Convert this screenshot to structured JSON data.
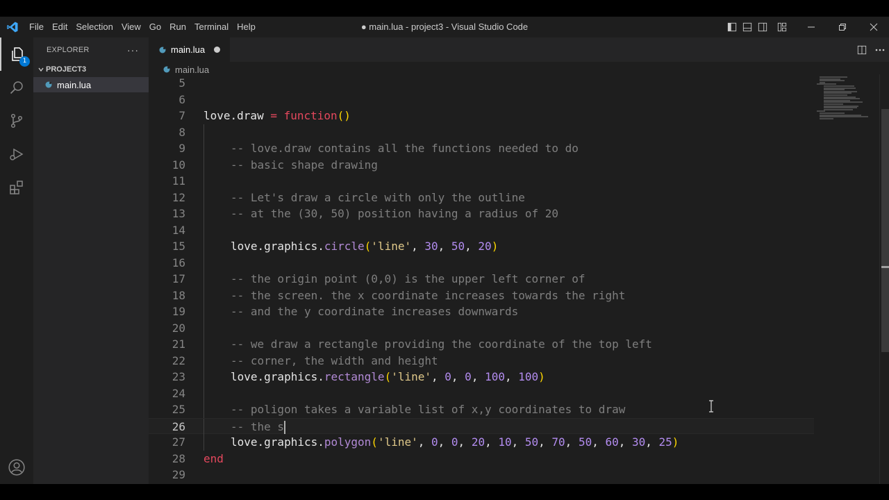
{
  "titlebar": {
    "menu": [
      "File",
      "Edit",
      "Selection",
      "View",
      "Go",
      "Run",
      "Terminal",
      "Help"
    ],
    "window_title": "● main.lua - project3 - Visual Studio Code"
  },
  "activitybar": {
    "items": [
      "explorer-icon",
      "search-icon",
      "source-control-icon",
      "run-debug-icon",
      "extensions-icon"
    ],
    "explorer_badge": "1",
    "bottom": "account-icon"
  },
  "sidebar": {
    "header": "EXPLORER",
    "more": "···",
    "section": "PROJECT3",
    "files": [
      {
        "name": "main.lua"
      }
    ]
  },
  "editor": {
    "tab_label": "main.lua",
    "breadcrumb": "main.lua",
    "lines": [
      {
        "n": "5"
      },
      {
        "n": "6"
      },
      {
        "n": "7"
      },
      {
        "n": "8"
      },
      {
        "n": "9"
      },
      {
        "n": "10"
      },
      {
        "n": "11"
      },
      {
        "n": "12"
      },
      {
        "n": "13"
      },
      {
        "n": "14"
      },
      {
        "n": "15"
      },
      {
        "n": "16"
      },
      {
        "n": "17"
      },
      {
        "n": "18"
      },
      {
        "n": "19"
      },
      {
        "n": "20"
      },
      {
        "n": "21"
      },
      {
        "n": "22"
      },
      {
        "n": "23"
      },
      {
        "n": "24"
      },
      {
        "n": "25"
      },
      {
        "n": "26"
      },
      {
        "n": "27"
      },
      {
        "n": "28"
      },
      {
        "n": "29"
      }
    ],
    "code": {
      "l7_a": "love.draw ",
      "l7_b": "=",
      "l7_c": " function",
      "l7_d": "()",
      "l9": "-- love.draw contains all the functions needed to do",
      "l10": "-- basic shape drawing",
      "l12": "-- Let's draw a circle with only the outline",
      "l13": "-- at the (30, 50) position having a radius of 20",
      "l15_a": "love.graphics.",
      "l15_b": "circle",
      "l15_c": "(",
      "l15_d": "'line'",
      "l15_e": ", ",
      "l15_f": "30",
      "l15_g": ", ",
      "l15_h": "50",
      "l15_i": ", ",
      "l15_j": "20",
      "l15_k": ")",
      "l17": "-- the origin point (0,0) is the upper left corner of",
      "l18": "-- the screen. the x coordinate increases towards the right",
      "l19": "-- and the y coordinate increases downwards",
      "l21": "-- we draw a rectangle providing the coordinate of the top left",
      "l22": "-- corner, the width and height",
      "l23_a": "love.graphics.",
      "l23_b": "rectangle",
      "l23_c": "(",
      "l23_d": "'line'",
      "l23_e": ", ",
      "l23_f": "0",
      "l23_g": ", ",
      "l23_h": "0",
      "l23_i": ", ",
      "l23_j": "100",
      "l23_k": ", ",
      "l23_l": "100",
      "l23_m": ")",
      "l25": "-- poligon takes a variable list of x,y coordinates to draw",
      "l26": "-- the s",
      "l27_a": "love.graphics.",
      "l27_b": "polygon",
      "l27_c": "(",
      "l27_d": "'line'",
      "l27_nums": [
        ", ",
        "0",
        ", ",
        "0",
        ", ",
        "20",
        ", ",
        "10",
        ", ",
        "50",
        ", ",
        "70",
        ", ",
        "50",
        ", ",
        "60",
        ", ",
        "30",
        ", ",
        "25"
      ],
      "l27_z": ")",
      "l28": "end"
    }
  },
  "colors": {
    "editor_bg": "#1e1e1e",
    "sidebar_bg": "#252526",
    "keyword": "#e5485d",
    "comment": "#7f7f7f",
    "string": "#e0c98a",
    "number": "#b38cf0",
    "method": "#b28ad6",
    "bracket": "#ffd700"
  }
}
